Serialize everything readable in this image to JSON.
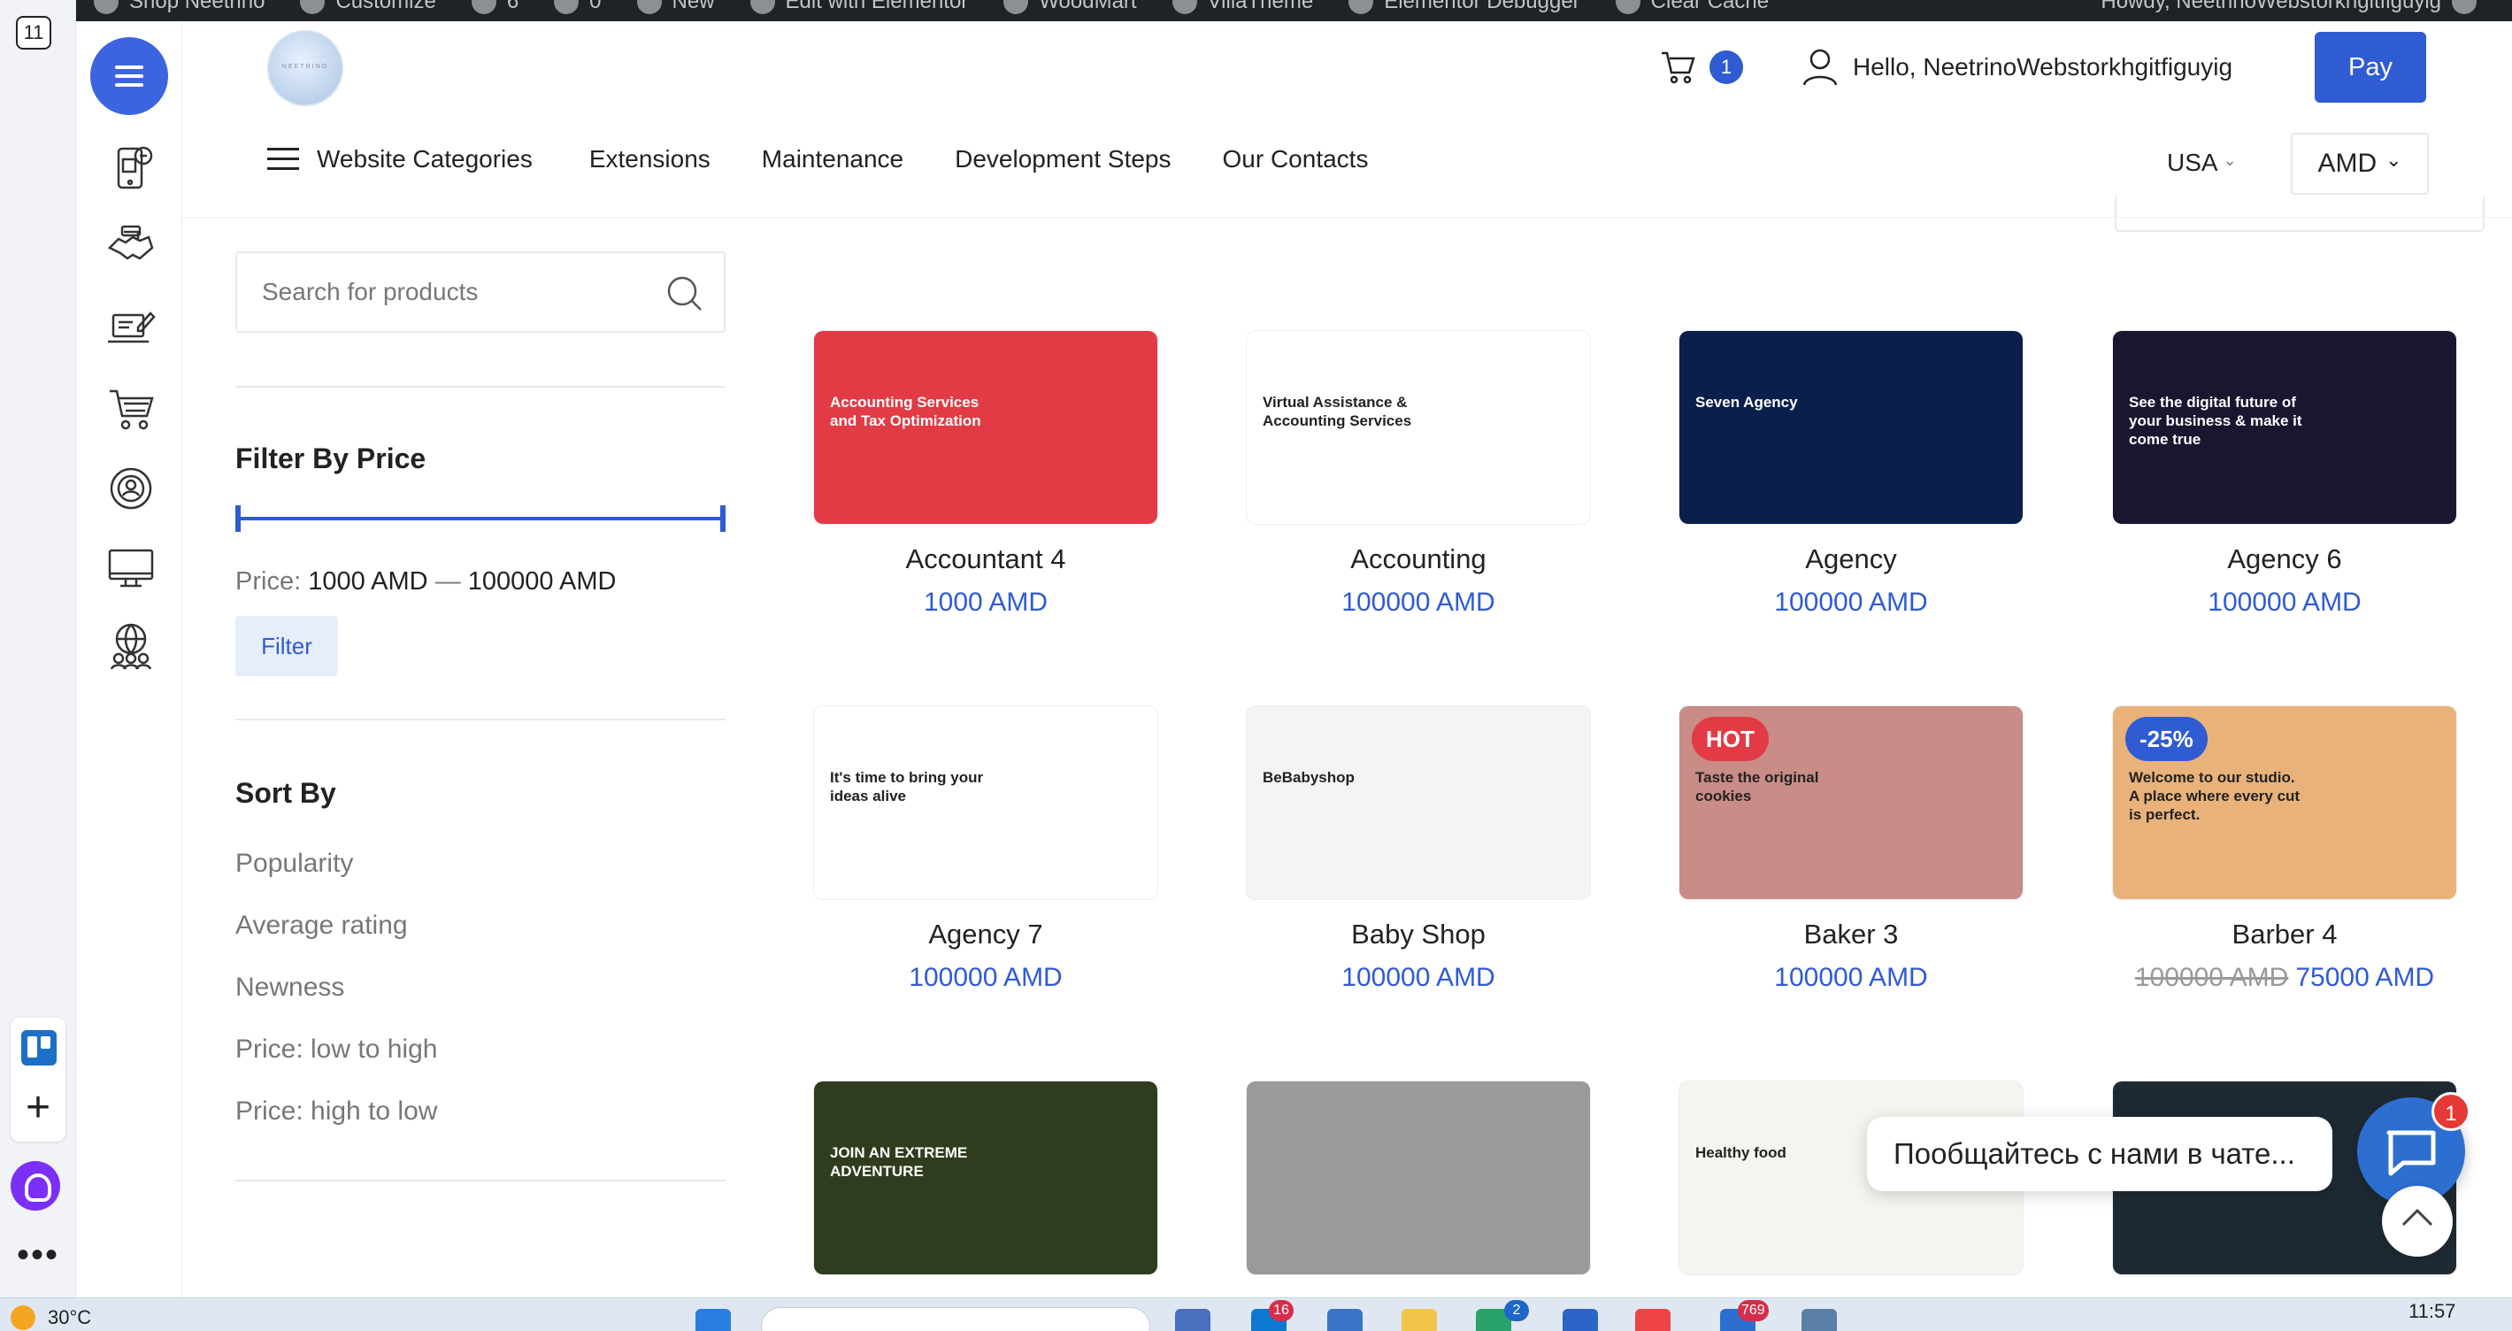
{
  "browser": {
    "tab_count": "11"
  },
  "admin_bar": {
    "items": [
      "Shop Neetrino",
      "Customize",
      "6",
      "0",
      "New",
      "Edit with Elementor",
      "WoodMart",
      "VillaTheme",
      "Elementor Debugger",
      "Clear Cache"
    ],
    "howdy": "Howdy, NeetrinoWebstorkhgitfiguyig"
  },
  "header": {
    "logo_text": "NEETRINO",
    "cart_count": "1",
    "greeting": "Hello, NeetrinoWebstorkhgitfiguyig",
    "pay_label": "Pay",
    "nav": {
      "categories_label": "Website Categories",
      "links": [
        "Extensions",
        "Maintenance",
        "Development Steps",
        "Our Contacts"
      ]
    },
    "country": "USA",
    "currency": "AMD"
  },
  "filters": {
    "search_placeholder": "Search for products",
    "price_title": "Filter By Price",
    "price_label": "Price:",
    "price_min": "1000 AMD",
    "price_sep": "—",
    "price_max": "100000 AMD",
    "filter_button": "Filter",
    "sort_title": "Sort By",
    "sort_options": [
      "Popularity",
      "Average rating",
      "Newness",
      "Price: low to high",
      "Price: high to low"
    ]
  },
  "products": [
    {
      "name": "Accountant 4",
      "price": "1000 AMD",
      "old_price": "",
      "badge": "",
      "thumb_text": "Accounting Services and Tax Optimization",
      "thumb_color": "#e23b45"
    },
    {
      "name": "Accounting",
      "price": "100000 AMD",
      "old_price": "",
      "badge": "",
      "thumb_text": "Virtual Assistance & Accounting Services",
      "thumb_color": "#ffffff"
    },
    {
      "name": "Agency",
      "price": "100000 AMD",
      "old_price": "",
      "badge": "",
      "thumb_text": "Seven Agency",
      "thumb_color": "#0b1f4d"
    },
    {
      "name": "Agency 6",
      "price": "100000 AMD",
      "old_price": "",
      "badge": "",
      "thumb_text": "See the digital future of your business & make it come true",
      "thumb_color": "#1b1530"
    },
    {
      "name": "Agency 7",
      "price": "100000 AMD",
      "old_price": "",
      "badge": "",
      "thumb_text": "It's time to bring your ideas alive",
      "thumb_color": "#ffffff"
    },
    {
      "name": "Baby Shop",
      "price": "100000 AMD",
      "old_price": "",
      "badge": "",
      "thumb_text": "BeBabyshop",
      "thumb_color": "#f4f4f6"
    },
    {
      "name": "Baker 3",
      "price": "100000 AMD",
      "old_price": "",
      "badge": "HOT",
      "thumb_text": "Taste the original cookies",
      "thumb_color": "#c98c86"
    },
    {
      "name": "Barber 4",
      "price": "75000 AMD",
      "old_price": "100000 AMD",
      "badge": "-25%",
      "thumb_text": "Welcome to our studio. A place where every cut is perfect.",
      "thumb_color": "#e8b27a"
    },
    {
      "name": "",
      "price": "",
      "old_price": "",
      "badge": "",
      "thumb_text": "JOIN AN EXTREME ADVENTURE",
      "thumb_color": "#2f3d1e"
    },
    {
      "name": "",
      "price": "",
      "old_price": "",
      "badge": "",
      "thumb_text": "",
      "thumb_color": "#9a9a9a"
    },
    {
      "name": "",
      "price": "",
      "old_price": "",
      "badge": "",
      "thumb_text": "Healthy food",
      "thumb_color": "#f6f4ef"
    },
    {
      "name": "",
      "price": "",
      "old_price": "",
      "badge": "",
      "thumb_text": "",
      "thumb_color": "#1e2a33"
    }
  ],
  "chat": {
    "message": "Пообщайтесь с нами в чате...",
    "badge": "1"
  },
  "taskbar": {
    "temperature": "30°C",
    "time": "11:57",
    "badges": [
      "16",
      "2",
      "769"
    ]
  },
  "colors": {
    "accent": "#2f5bd3",
    "hot": "#e23b45",
    "sale": "#2f5bd3"
  }
}
